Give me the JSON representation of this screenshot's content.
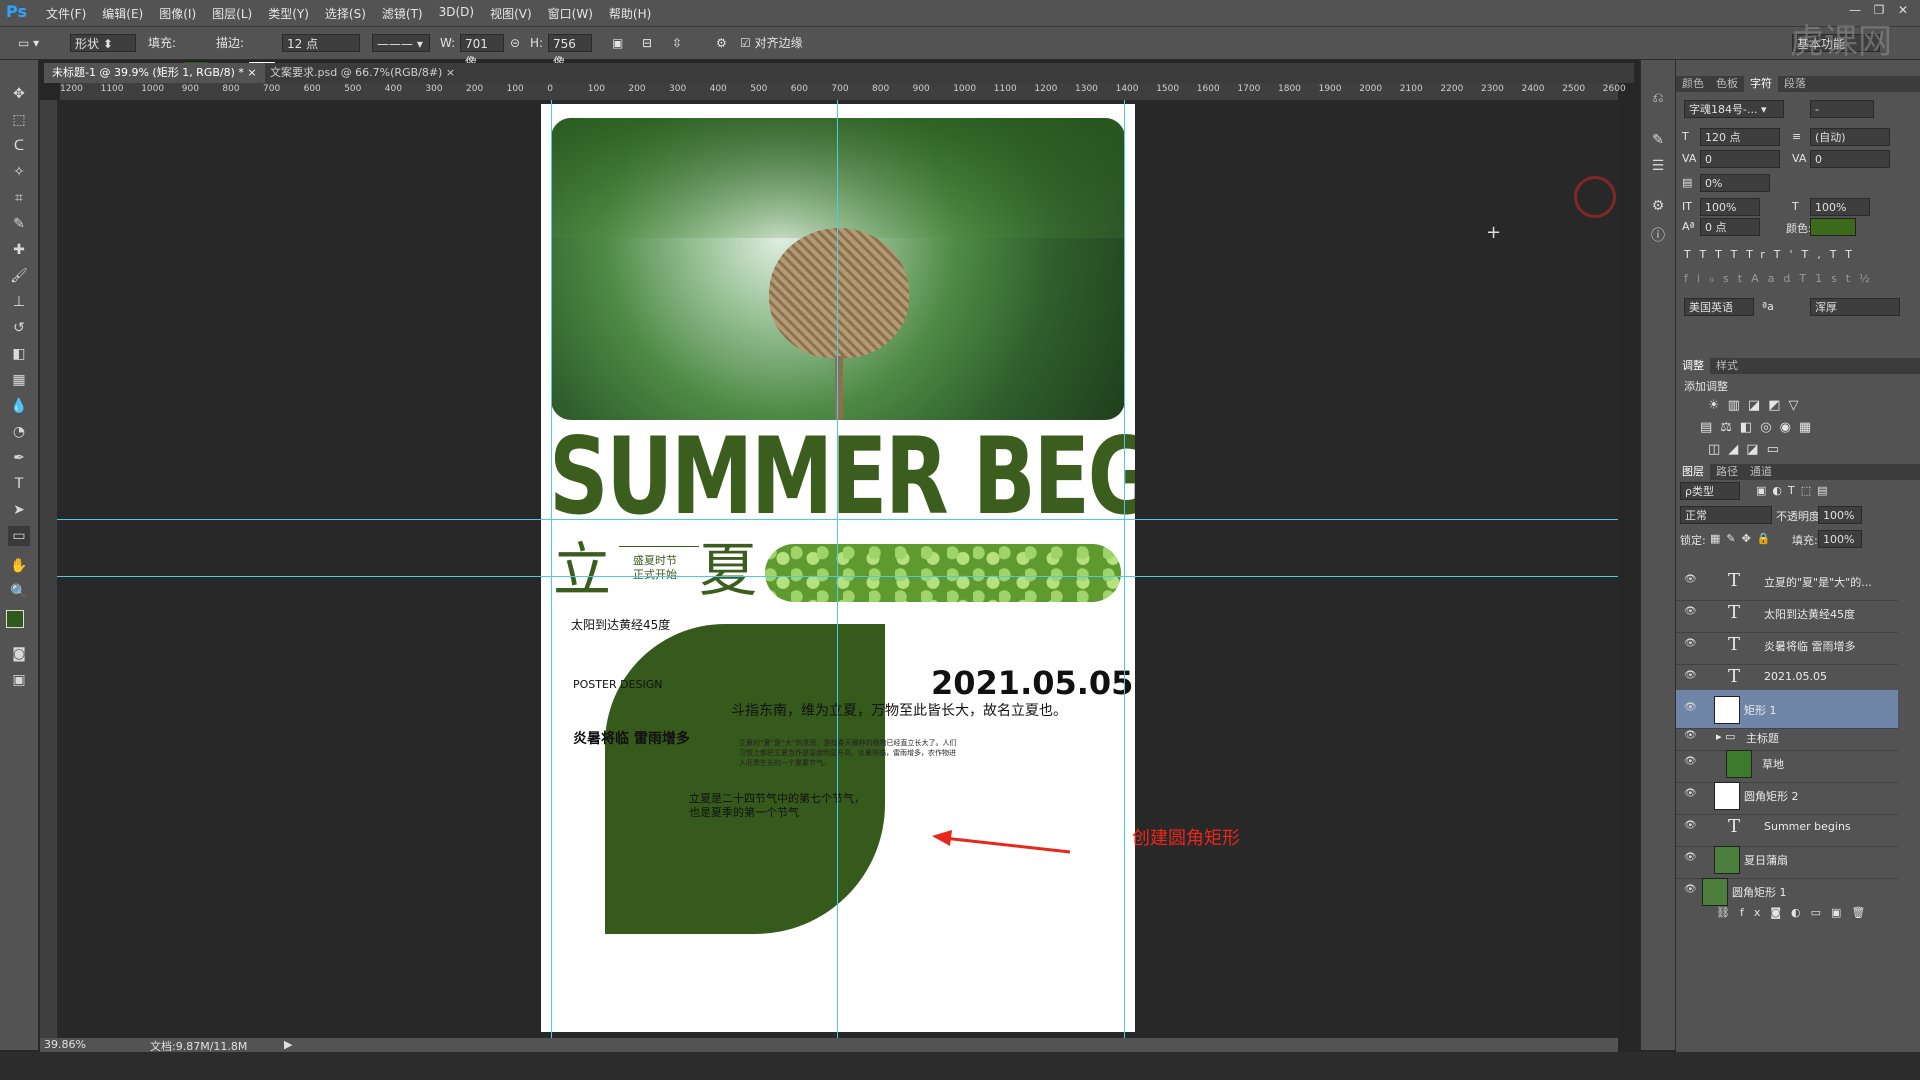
{
  "app": {
    "logo": "Ps"
  },
  "menu": [
    "文件(F)",
    "编辑(E)",
    "图像(I)",
    "图层(L)",
    "类型(Y)",
    "选择(S)",
    "滤镜(T)",
    "3D(D)",
    "视图(V)",
    "窗口(W)",
    "帮助(H)"
  ],
  "options": {
    "shape_mode": "形状",
    "fill_label": "填充:",
    "fill_color": "#2f5a1c",
    "stroke_label": "描边:",
    "stroke_size": "12 点",
    "w_label": "W:",
    "w_value": "701 像",
    "h_label": "H:",
    "h_value": "756 像",
    "align_edges": "对齐边缘",
    "workspace": "基本功能"
  },
  "tabs": [
    {
      "label": "未标题-1 @ 39.9% (矩形 1, RGB/8) *",
      "active": true
    },
    {
      "label": "文案要求.psd @ 66.7%(RGB/8#)",
      "active": false
    }
  ],
  "ruler_h": [
    "1200",
    "1100",
    "1000",
    "900",
    "800",
    "700",
    "600",
    "500",
    "400",
    "300",
    "200",
    "100",
    "0",
    "100",
    "200",
    "300",
    "400",
    "500",
    "600",
    "700",
    "800",
    "900",
    "1000",
    "1100",
    "1200",
    "1300",
    "1400",
    "1500",
    "1600",
    "1700",
    "1800",
    "1900",
    "2000",
    "2100",
    "2200",
    "2300",
    "2400",
    "2500",
    "2600"
  ],
  "poster": {
    "headline": "SUMMER BEGINS",
    "char1": "立",
    "char2": "夏",
    "sub1": "盛夏时节",
    "sub2": "正式开始",
    "sun_text": "太阳到达黄经45度",
    "poster_design": "POSTER DESIGN",
    "date": "2021.05.05",
    "proverb": "斗指东南，维为立夏，万物至此皆长大，故名立夏也。",
    "storm": "炎暑将临 雷雨增多",
    "small_para": "立夏的“夏”是“大”的意思，是指春天播种的植物已经直立长大了。人们习惯上都把立夏当作是温度明显升高，炎暑将临，雷雨增多，农作物进入旺季生长的一个重要节气。",
    "term_line1": "立夏是二十四节气中的第七个节气，",
    "term_line2": "也是夏季的第一个节气",
    "accent_green": "#3b5e1e"
  },
  "annotation": {
    "text": "创建圆角矩形",
    "color": "#e8261c"
  },
  "status": {
    "zoom": "39.86%",
    "doc": "文档:9.87M/11.8M"
  },
  "character_panel": {
    "tabs": [
      "颜色",
      "色板",
      "字符",
      "段落"
    ],
    "active_tab": "字符",
    "font": "字魂184号-...",
    "font_style": "-",
    "size": "120 点",
    "leading": "(自动)",
    "kerning": "0",
    "tracking": "0",
    "scale_pct": "0%",
    "vscale": "100%",
    "hscale": "100%",
    "baseline": "0 点",
    "color_label": "颜色:",
    "color": "#3b6a1a",
    "language": "美国英语",
    "aa_label": "ªa",
    "aa": "浑厚",
    "style_buttons": [
      "T",
      "T",
      "TT",
      "Tr",
      "T'",
      "T,",
      "T",
      "T"
    ],
    "ot_buttons": [
      "fi",
      "ℴ",
      "st",
      "A",
      "ad",
      "T",
      "1st",
      "½"
    ]
  },
  "adjust_panel": {
    "tabs": [
      "调整",
      "样式"
    ],
    "title": "添加调整"
  },
  "layers_panel": {
    "tabs": [
      "图层",
      "路径",
      "通道"
    ],
    "filter": "ρ类型",
    "blend": "正常",
    "opacity_label": "不透明度:",
    "opacity": "100%",
    "lock_label": "锁定:",
    "fill_label": "填充:",
    "fill": "100%",
    "layers": [
      {
        "name": "立夏的\"夏\"是\"大\"的...",
        "kind": "text"
      },
      {
        "name": "太阳到达黄经45度",
        "kind": "text"
      },
      {
        "name": "炎暑将临 雷雨增多",
        "kind": "text"
      },
      {
        "name": "2021.05.05",
        "kind": "text"
      },
      {
        "name": "矩形 1",
        "kind": "shape",
        "selected": true
      },
      {
        "name": "主标题",
        "kind": "group"
      },
      {
        "name": "草地",
        "kind": "image"
      },
      {
        "name": "圆角矩形 2",
        "kind": "shape"
      },
      {
        "name": "Summer begins",
        "kind": "text"
      },
      {
        "name": "夏日蒲扇",
        "kind": "image"
      },
      {
        "name": "圆角矩形 1",
        "kind": "shape"
      }
    ]
  }
}
